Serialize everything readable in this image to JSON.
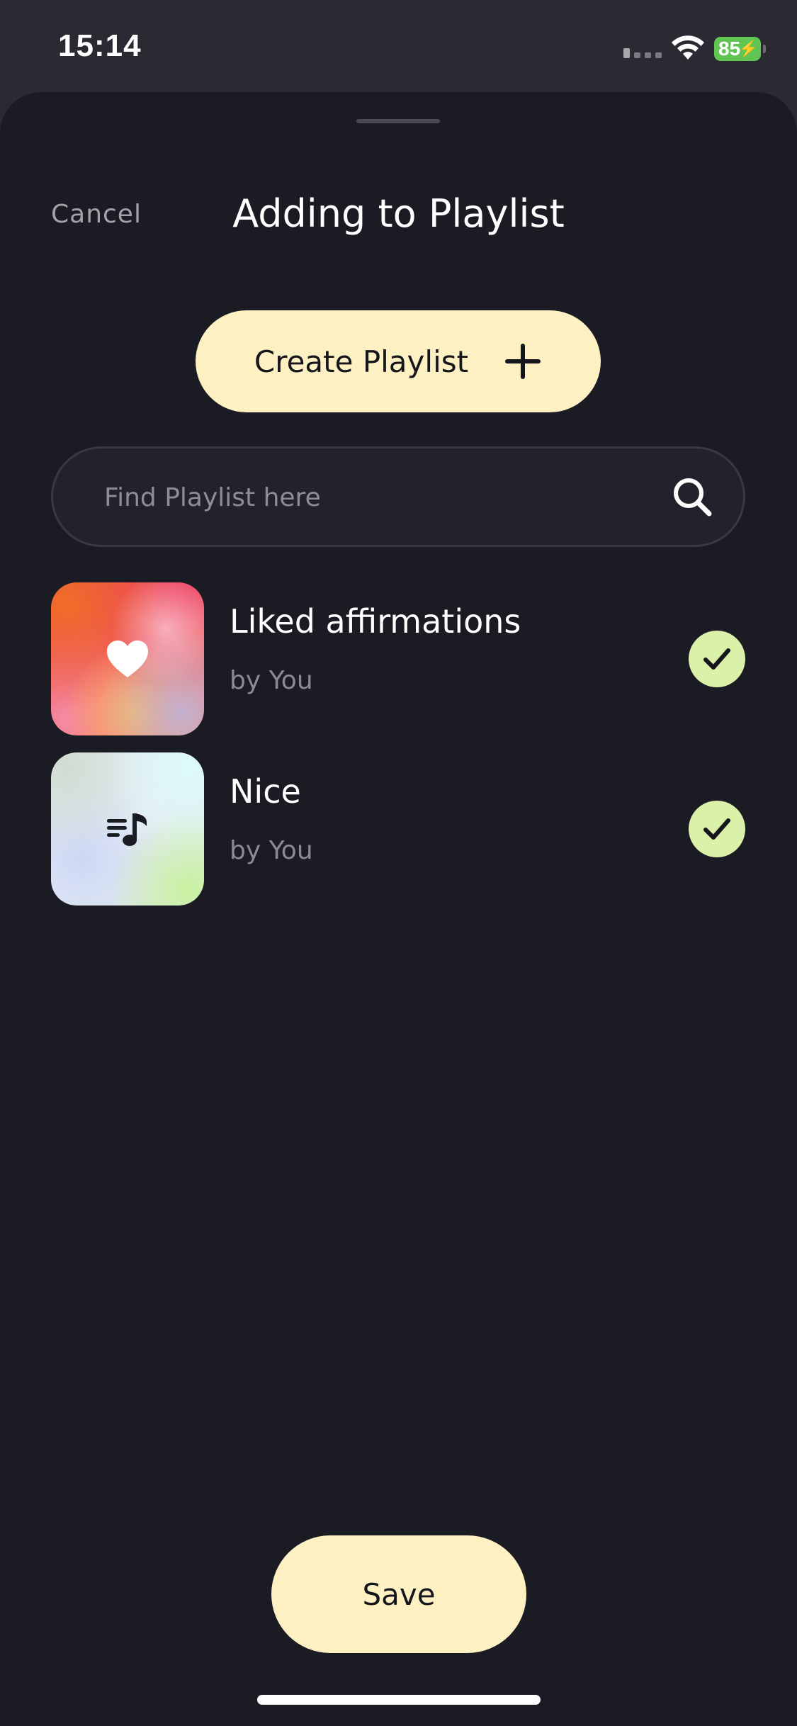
{
  "status_bar": {
    "time": "15:14",
    "battery": "85"
  },
  "sheet": {
    "cancel_label": "Cancel",
    "title": "Adding to Playlist",
    "create_label": "Create Playlist",
    "search_placeholder": "Find Playlist here",
    "search_value": "",
    "save_label": "Save"
  },
  "playlists": [
    {
      "name": "Liked affirmations",
      "owner": "by You",
      "selected": true,
      "icon": "heart-icon"
    },
    {
      "name": "Nice",
      "owner": "by You",
      "selected": true,
      "icon": "music-queue-icon"
    }
  ],
  "colors": {
    "background": "#1b1b24",
    "accent_button": "#fdf1c4",
    "check": "#dbf0a8",
    "battery": "#61c554"
  }
}
